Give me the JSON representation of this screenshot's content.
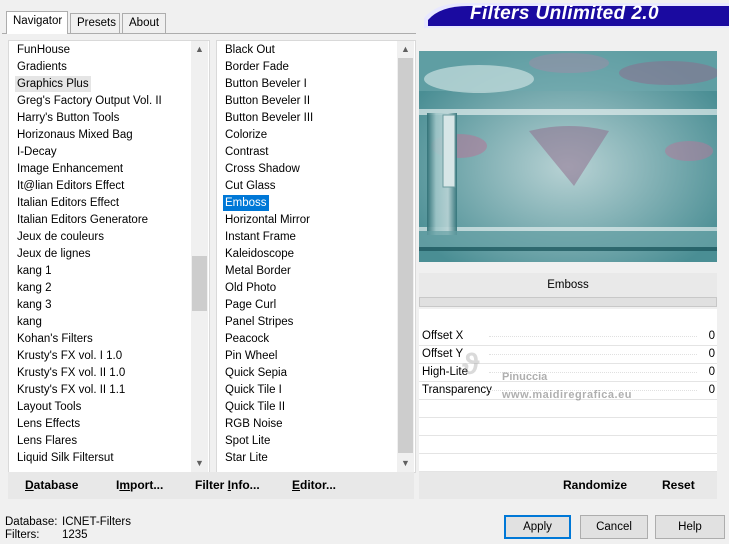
{
  "tabs": [
    "Navigator",
    "Presets",
    "About"
  ],
  "banner_title": "Filters Unlimited 2.0",
  "categories": [
    "FunHouse",
    "Gradients",
    "Graphics Plus",
    "Greg's Factory Output Vol. II",
    "Harry's Button Tools",
    "Horizonaus Mixed Bag",
    "I-Decay",
    "Image Enhancement",
    "It@lian Editors Effect",
    "Italian Editors Effect",
    "Italian Editors Generatore",
    "Jeux de couleurs",
    "Jeux de lignes",
    "kang 1",
    "kang 2",
    "kang 3",
    "kang",
    "Kohan's Filters",
    "Krusty's FX vol. I 1.0",
    "Krusty's FX vol. II 1.0",
    "Krusty's FX vol. II 1.1",
    "Layout Tools",
    "Lens Effects",
    "Lens Flares",
    "Liquid Silk Filtersut"
  ],
  "selected_category": "Graphics Plus",
  "filters": [
    "Black Out",
    "Border Fade",
    "Button Beveler I",
    "Button Beveler II",
    "Button Beveler III",
    "Colorize",
    "Contrast",
    "Cross Shadow",
    "Cut Glass",
    "Emboss",
    "Horizontal Mirror",
    "Instant Frame",
    "Kaleidoscope",
    "Metal Border",
    "Old Photo",
    "Page Curl",
    "Panel Stripes",
    "Peacock",
    "Pin Wheel",
    "Quick Sepia",
    "Quick Tile I",
    "Quick Tile II",
    "RGB Noise",
    "Spot Lite",
    "Star Lite"
  ],
  "selected_filter": "Emboss",
  "current_filter_title": "Emboss",
  "params": [
    {
      "label": "Offset X",
      "value": "0"
    },
    {
      "label": "Offset Y",
      "value": "0"
    },
    {
      "label": "High-Lite",
      "value": "0"
    },
    {
      "label": "Transparency",
      "value": "0"
    }
  ],
  "watermark": {
    "line1": "Pinuccia",
    "line2": "www.maidiregrafica.eu"
  },
  "left_toolbar": {
    "database": "Database",
    "import": "Import...",
    "filter_info": "Filter Info...",
    "editor": "Editor..."
  },
  "right_toolbar": {
    "randomize": "Randomize",
    "reset": "Reset"
  },
  "status": {
    "database_label": "Database:",
    "database_value": "ICNET-Filters",
    "filters_label": "Filters:",
    "filters_value": "1235"
  },
  "buttons": {
    "apply": "Apply",
    "cancel": "Cancel",
    "help": "Help"
  },
  "colors": {
    "banner": "#1a0aa0",
    "selection": "#0078d7",
    "preview_teal": "#5a9ea3",
    "preview_pink": "#b07a9a"
  },
  "scroll": {
    "categories_position": 0.62,
    "filters_position": 0.0
  }
}
